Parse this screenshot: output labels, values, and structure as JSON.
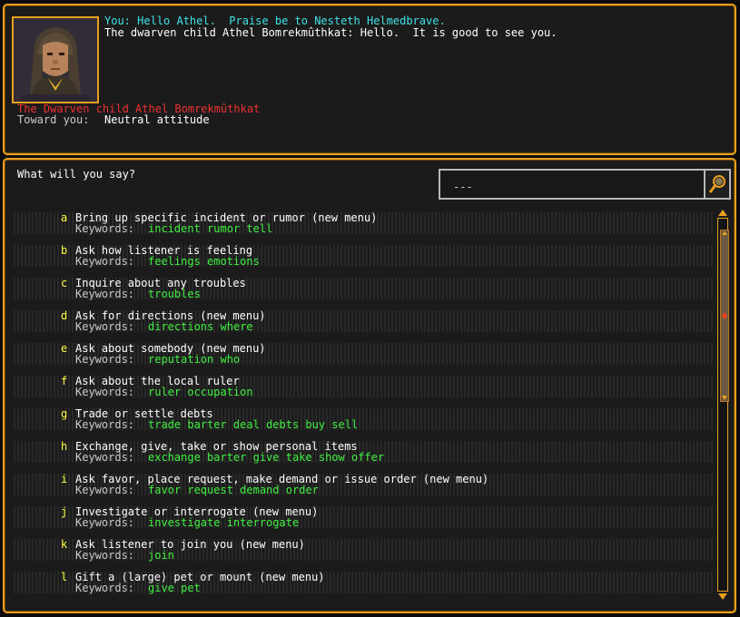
{
  "conversation": {
    "player_line": "You: Hello Athel.  Praise be to Nesteth Helmedbrave.",
    "listener_line": "The dwarven child Athel Bomrekmûthkat: Hello.  It is good to see you.",
    "listener_name": "The Dwarven child Athel Bomrekmûthkat",
    "attitude_label": "Toward you:",
    "attitude_value": "Neutral attitude"
  },
  "prompt": "What will you say?",
  "search": {
    "value": "---"
  },
  "keywords_label": "Keywords:",
  "options": [
    {
      "key": "a",
      "label": "Bring up specific incident or rumor (new menu)",
      "keywords": "incident rumor tell"
    },
    {
      "key": "b",
      "label": "Ask how listener is feeling",
      "keywords": "feelings emotions"
    },
    {
      "key": "c",
      "label": "Inquire about any troubles",
      "keywords": "troubles"
    },
    {
      "key": "d",
      "label": "Ask for directions (new menu)",
      "keywords": "directions where"
    },
    {
      "key": "e",
      "label": "Ask about somebody (new menu)",
      "keywords": "reputation who"
    },
    {
      "key": "f",
      "label": "Ask about the local ruler",
      "keywords": "ruler occupation"
    },
    {
      "key": "g",
      "label": "Trade or settle debts",
      "keywords": "trade barter deal debts buy sell"
    },
    {
      "key": "h",
      "label": "Exchange, give, take or show personal items",
      "keywords": "exchange barter give take show offer"
    },
    {
      "key": "i",
      "label": "Ask favor, place request, make demand or issue order (new menu)",
      "keywords": "favor request demand order"
    },
    {
      "key": "j",
      "label": "Investigate or interrogate (new menu)",
      "keywords": "investigate interrogate"
    },
    {
      "key": "k",
      "label": "Ask listener to join you (new menu)",
      "keywords": "join"
    },
    {
      "key": "l",
      "label": "Gift a (large) pet or mount (new menu)",
      "keywords": "give pet"
    }
  ],
  "colors": {
    "border": "#e8a020",
    "player_text": "#3fe3e8",
    "listener_name": "#f03030",
    "hotkey": "#ffff40",
    "keyword": "#40f040"
  },
  "icons": {
    "search_button": "magnifier-icon",
    "portrait": "dwarf-child-portrait",
    "scroll_up": "scroll-up-arrow-icon",
    "scroll_down": "scroll-down-arrow-icon"
  }
}
